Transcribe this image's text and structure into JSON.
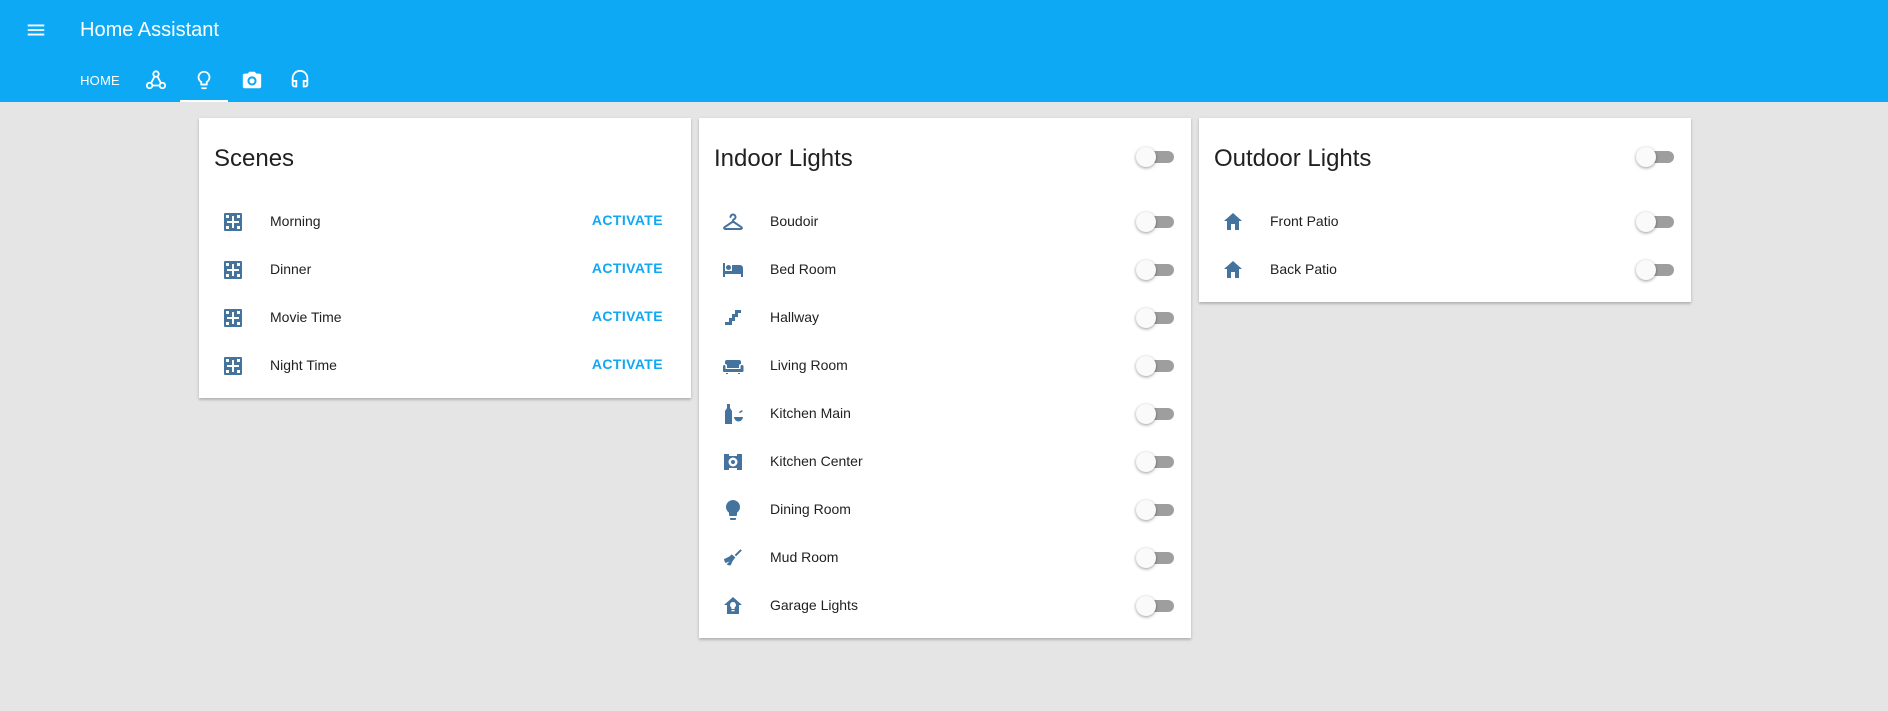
{
  "header": {
    "title": "Home Assistant",
    "menu_icon": "menu-icon",
    "tabs": [
      {
        "label": "HOME",
        "active": false
      },
      {
        "icon": "group-icon",
        "active": false
      },
      {
        "icon": "lightbulb-outline-icon",
        "active": true
      },
      {
        "icon": "camera-icon",
        "active": false
      },
      {
        "icon": "headphones-icon",
        "active": false
      }
    ]
  },
  "colors": {
    "accent": "#0da9f4",
    "icon": "#44739e",
    "background": "#e5e5e5"
  },
  "scenes": {
    "title": "Scenes",
    "action_label": "ACTIVATE",
    "items": [
      {
        "label": "Morning",
        "icon": "scene-icon"
      },
      {
        "label": "Dinner",
        "icon": "scene-icon"
      },
      {
        "label": "Movie Time",
        "icon": "scene-icon"
      },
      {
        "label": "Night Time",
        "icon": "scene-icon"
      }
    ]
  },
  "indoor": {
    "title": "Indoor Lights",
    "master_on": false,
    "items": [
      {
        "label": "Boudoir",
        "icon": "hanger-icon",
        "on": false
      },
      {
        "label": "Bed Room",
        "icon": "bed-icon",
        "on": false
      },
      {
        "label": "Hallway",
        "icon": "stairs-icon",
        "on": false
      },
      {
        "label": "Living Room",
        "icon": "sofa-icon",
        "on": false
      },
      {
        "label": "Kitchen Main",
        "icon": "bottle-bowl-icon",
        "on": false
      },
      {
        "label": "Kitchen Center",
        "icon": "projector-icon",
        "on": false
      },
      {
        "label": "Dining Room",
        "icon": "lightbulb-icon",
        "on": false
      },
      {
        "label": "Mud Room",
        "icon": "broom-icon",
        "on": false
      },
      {
        "label": "Garage Lights",
        "icon": "home-lightbulb-icon",
        "on": false
      }
    ]
  },
  "outdoor": {
    "title": "Outdoor Lights",
    "master_on": false,
    "items": [
      {
        "label": "Front Patio",
        "icon": "home-icon",
        "on": false
      },
      {
        "label": "Back Patio",
        "icon": "home-icon",
        "on": false
      }
    ]
  }
}
